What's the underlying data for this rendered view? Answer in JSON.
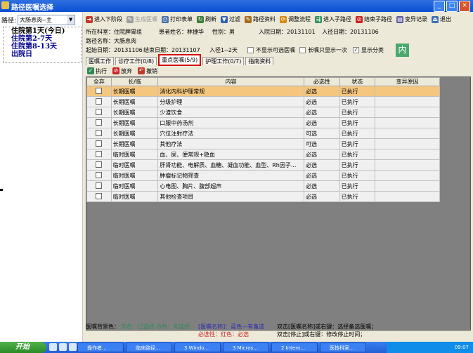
{
  "window": {
    "title": "路径医嘱选择"
  },
  "left": {
    "path_label": "路径:",
    "path_value": "大肠息肉--主",
    "stages": [
      "住院第1天(今日)",
      "住院第2-7天",
      "住院第8-13天",
      "出院日"
    ]
  },
  "toolbar": {
    "items": [
      {
        "label": "进入下阶段",
        "icon": "next-stage-icon",
        "color": "#c0392b",
        "enabled": true
      },
      {
        "label": "生成医嘱",
        "icon": "generate-icon",
        "color": "#9e9e9e",
        "enabled": false
      },
      {
        "label": "打印表单",
        "icon": "print-icon",
        "color": "#4a6fa5",
        "enabled": true
      },
      {
        "label": "刷新",
        "icon": "refresh-icon",
        "color": "#3c7d3c",
        "enabled": true
      },
      {
        "label": "过滤",
        "icon": "filter-icon",
        "color": "#2d5fb3",
        "enabled": true
      },
      {
        "label": "路径资料",
        "icon": "path-info-icon",
        "color": "#a56b1d",
        "enabled": true
      },
      {
        "label": "调整流程",
        "icon": "adjust-flow-icon",
        "color": "#d58a17",
        "enabled": true
      },
      {
        "label": "进入子路径",
        "icon": "subpath-icon",
        "color": "#2e8b57",
        "enabled": true
      },
      {
        "label": "结束子路径",
        "icon": "end-subpath-icon",
        "color": "#cc2222",
        "enabled": true
      },
      {
        "label": "变异记录",
        "icon": "variance-icon",
        "color": "#5a5a9e",
        "enabled": true
      },
      {
        "label": "退出",
        "icon": "exit-icon",
        "color": "#3b6fb6",
        "enabled": true
      }
    ]
  },
  "info": {
    "dept": "所在科室：住院脾胃组",
    "patient": "患者姓名：林捷华",
    "gender": "性别：男",
    "admit_date": "入院日期：20131101",
    "path_admit_date": "入径日期：20131106",
    "path_name": "路径名称：大肠息肉",
    "start_date": "起始日期：20131106",
    "end_date": "结束日期：20131107",
    "path_day": "入径1--2天",
    "opt_hide_optional": "不显示可选医嘱",
    "opt_long_term_once": "长嘱只显示一次",
    "opt_show_category": "显示分类",
    "dept_badge": "内"
  },
  "tabs": [
    "医嘱工作",
    "诊疗工作(0/8)",
    "重点医嘱(5/9)",
    "护理工作(0/7)",
    "指南资料"
  ],
  "subtoolbar": {
    "execute": "执行",
    "abandon": "放弃",
    "cancel": "撤销"
  },
  "table": {
    "headers": [
      "全弃",
      "长/临",
      "内容",
      "必选性",
      "状态",
      "变异原因"
    ],
    "rows": [
      {
        "type": "长期医嘱",
        "content": "消化内科护理常规",
        "req": "必选",
        "status": "已执行",
        "selected": true
      },
      {
        "type": "长期医嘱",
        "content": "分级护理",
        "req": "必选",
        "status": "已执行"
      },
      {
        "type": "长期医嘱",
        "content": "少渣饮食",
        "req": "必选",
        "status": "已执行"
      },
      {
        "type": "长期医嘱",
        "content": "口服中药汤剂",
        "req": "必选",
        "status": "已执行"
      },
      {
        "type": "长期医嘱",
        "content": "穴位注射疗法",
        "req": "可选",
        "status": "已执行"
      },
      {
        "type": "长期医嘱",
        "content": "其他疗法",
        "req": "可选",
        "status": "已执行"
      },
      {
        "type": "临时医嘱",
        "content": "血、尿、便常规+隐血",
        "req": "必选",
        "status": "已执行"
      },
      {
        "type": "临时医嘱",
        "content": "肝肾功能、电解质、血糖、凝血功能、血型、Rh因子...",
        "req": "必选",
        "status": "已执行"
      },
      {
        "type": "临时医嘱",
        "content": "肿瘤标记物筛查",
        "req": "必选",
        "status": "已执行"
      },
      {
        "type": "临时医嘱",
        "content": "心电图、胸片、腹部超声",
        "req": "必选",
        "status": "已执行"
      },
      {
        "type": "临时医嘱",
        "content": "其他检查项目",
        "req": "必选",
        "status": "已执行"
      }
    ]
  },
  "legend": {
    "bg": "医嘱背景色：",
    "gray": "灰色：已选择",
    "white": "白色：未选择",
    "name_color": "[医嘱名称]：蓝色—有备选",
    "req_color": "必选性：红色：必选",
    "dbl_click": "双击[医嘱名称]或右键：选择备选医嘱；",
    "dbl_stop": "双击[停止]或右键：修改停止时间；"
  },
  "taskbar": {
    "start": "开始",
    "tasks": [
      "操作者...",
      "临床路径...",
      "3 Windo...",
      "3 Micros...",
      "2 Intern...",
      "医技科室..."
    ],
    "time": "09:07"
  }
}
